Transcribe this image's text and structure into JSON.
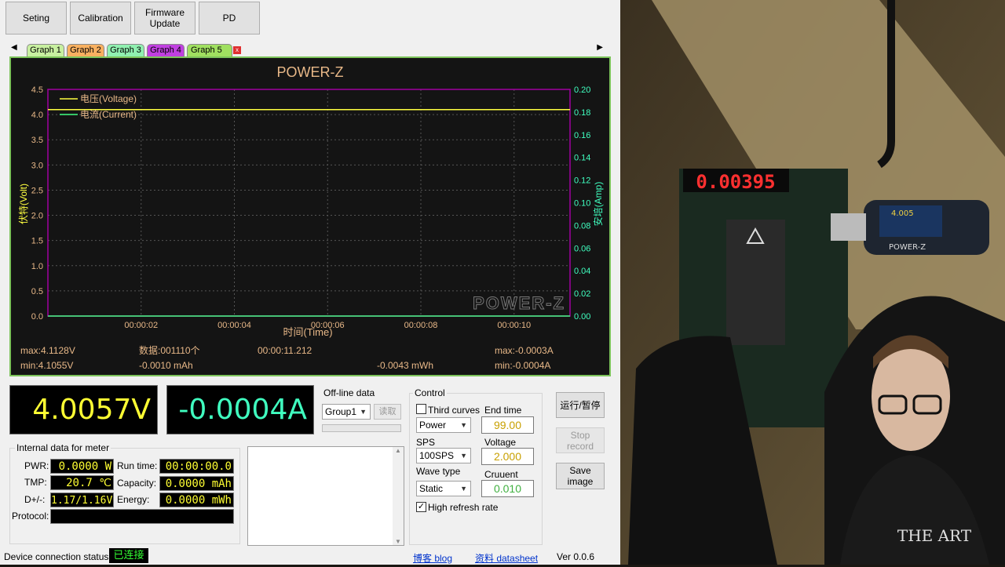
{
  "toolbar": {
    "setting": "Seting",
    "calibration": "Calibration",
    "firmware_update": "Firmware\nUpdate",
    "pd": "PD"
  },
  "tabs": [
    {
      "label": "Graph 1",
      "color": "#c8f0a0"
    },
    {
      "label": "Graph 2",
      "color": "#f8b060"
    },
    {
      "label": "Graph 3",
      "color": "#90f0b0"
    },
    {
      "label": "Graph 4",
      "color": "#c040e0"
    },
    {
      "label": "Graph 5",
      "color": "#a0e060"
    }
  ],
  "graph": {
    "title": "POWER-Z",
    "watermark": "POWER-Z",
    "legend_voltage": "电压(Voltage)",
    "legend_current": "电流(Current)",
    "y_left_label": "伏特(Volt)",
    "y_right_label": "安培(Amp)",
    "x_label": "时间(Time)",
    "y_left_ticks": [
      "4.5",
      "4.0",
      "3.5",
      "3.0",
      "2.5",
      "2.0",
      "1.5",
      "1.0",
      "0.5",
      "0.0"
    ],
    "y_right_ticks": [
      "0.20",
      "0.18",
      "0.16",
      "0.14",
      "0.12",
      "0.10",
      "0.08",
      "0.06",
      "0.04",
      "0.02",
      "0.00"
    ],
    "x_ticks": [
      "00:00:02",
      "00:00:04",
      "00:00:06",
      "00:00:08",
      "00:00:10"
    ],
    "stats": {
      "v_max": "max:4.1128V",
      "v_min": "min:4.1055V",
      "data_count": "数据:001110个",
      "charge": "-0.0010 mAh",
      "elapsed": "00:00:11.212",
      "energy": "-0.0043 mWh",
      "a_max": "max:-0.0003A",
      "a_min": "min:-0.0004A"
    },
    "colors": {
      "voltage": "#ffff40",
      "current": "#40ff80",
      "axis": "#a000a0",
      "text": "#e8b888"
    }
  },
  "chart_data": {
    "type": "line",
    "title": "POWER-Z",
    "xlabel": "时间(Time)",
    "ylabel": "伏特(Volt)",
    "y2label": "安培(Amp)",
    "xlim": [
      0,
      11.2
    ],
    "ylim": [
      0,
      4.5
    ],
    "y2lim": [
      0,
      0.2
    ],
    "x": [
      0,
      11.2
    ],
    "series": [
      {
        "name": "电压(Voltage)",
        "axis": "left",
        "values": [
          4.1,
          4.1
        ]
      },
      {
        "name": "电流(Current)",
        "axis": "right",
        "values": [
          0.0,
          0.0
        ]
      }
    ],
    "grid": true,
    "legend": "top-left"
  },
  "readouts": {
    "voltage": "4.0057V",
    "current": "-0.0004A"
  },
  "offline": {
    "title": "Off-line data",
    "group": "Group1",
    "read_btn": "读取"
  },
  "internal": {
    "title": "Internal data for meter",
    "pwr_label": "PWR:",
    "pwr_value": "0.0000 W",
    "tmp_label": "TMP:",
    "tmp_value": "20.7 ℃",
    "dpm_label": "D+/-:",
    "dpm_value": "1.17/1.16V",
    "protocol_label": "Protocol:",
    "runtime_label": "Run time:",
    "runtime_value": "00:00:00.0",
    "capacity_label": "Capacity:",
    "capacity_value": "0.0000 mAh",
    "energy_label": "Energy:",
    "energy_value": "0.0000 mWh"
  },
  "control": {
    "title": "Control",
    "third_curves": "Third curves",
    "mode": "Power",
    "sps_label": "SPS",
    "sps": "100SPS",
    "wave_label": "Wave type",
    "wave": "Static",
    "high_refresh": "High refresh rate",
    "end_time_label": "End time",
    "end_time": "99.00",
    "voltage_label": "Voltage",
    "voltage": "2.000",
    "current_label": "Cruuent",
    "current": "0.010"
  },
  "buttons": {
    "run_pause": "运行/暂停",
    "stop_record": "Stop\nrecord",
    "save_image": "Save\nimage"
  },
  "status": {
    "label": "Device connection status:",
    "value": "已连接",
    "blog": "博客 blog",
    "datasheet": "资料 datasheet",
    "version": "Ver 0.0.6"
  },
  "device": {
    "display": "0.00395",
    "meter_brand": "POWER-Z",
    "meter_reading": "4.005",
    "logo_text": "THE ART"
  }
}
